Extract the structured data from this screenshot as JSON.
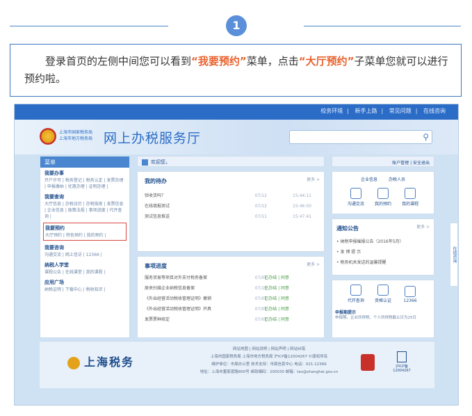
{
  "step": {
    "number": "1"
  },
  "instruction": {
    "part1": "登录首页的左侧中间您可以看到",
    "hl1": "“我要预约”",
    "part2": "菜单，点击",
    "hl2": "“大厅预约”",
    "part3": "子菜单您就可以进行预约啦。"
  },
  "topbar": {
    "links": [
      "校务环境",
      "新手上路",
      "常见问题",
      "在线咨询"
    ]
  },
  "header": {
    "bureau_line1": "上海市国家税务局",
    "bureau_line2": "上海市地方税务局",
    "title": "网上办税服务厅"
  },
  "sidebar": {
    "menu_label": "菜单",
    "groups": [
      {
        "title": "我要办事",
        "sub": "开户许可 | 税务登记 | 税务认定 | 发票办理 | 申报缴纳 | 优惠办理 | 证明办理 |"
      },
      {
        "title": "我要查询",
        "sub": "大厅信息 | 办税日历 | 办税指南 | 发票信息 | 企业信息 | 政策法规 | 事项进度 | 代开查询 |"
      },
      {
        "title": "我要预约",
        "sub": "大厅预约 | 特色预约 | 我的预约 |"
      },
      {
        "title": "我要咨询",
        "sub": "沟通交流 | 网上信访 | 12366 |"
      },
      {
        "title": "纳税人学堂",
        "sub": "课程公告 | 在线课堂 | 我的课程 |"
      },
      {
        "title": "应用广场",
        "sub": "纳税证明 | 下载中心 | 税收知识 |"
      }
    ]
  },
  "welcome": {
    "label": "欢迎您，"
  },
  "userbar": {
    "label": "账户管理 | 安全退出"
  },
  "todo": {
    "title": "我的待办",
    "more": "更多 >",
    "rows": [
      {
        "text": "验收货吗？",
        "date": "07/12",
        "time": "15:44:11"
      },
      {
        "text": "在线填报测试",
        "date": "07/12",
        "time": "15:46:50"
      },
      {
        "text": "测试信息推送",
        "date": "07/11",
        "time": "15:47:41"
      }
    ]
  },
  "progress": {
    "title": "事项进度",
    "more": "更多 >",
    "rows": [
      {
        "text": "服务贸易等项目对外支付税务备案",
        "date": "07/01",
        "status": "已办结 | 同意"
      },
      {
        "text": "原来扫描企业纳税信息备案",
        "date": "07/16",
        "status": "已办结 | 同意"
      },
      {
        "text": "《外出经营活动税收管理证明》缴销",
        "date": "07/01",
        "status": "已办结 | 同意"
      },
      {
        "text": "《外出经营活动税收管理证明》开具",
        "date": "07/01",
        "status": "已办结 | 同意"
      },
      {
        "text": "发票票种核定",
        "date": "07/01",
        "status": "已办结 | 同意"
      }
    ]
  },
  "rightpanel": {
    "links": [
      "企业信息",
      "办税人员"
    ],
    "icons": [
      "沟通交流",
      "我的预约",
      "我的课程"
    ],
    "notice_title": "通知公告",
    "notice_more": "更多 >",
    "notices": [
      "• 纳税申报催报公告（2016年5月）",
      "• 发 博 提 示",
      "• 税务机关发送的温馨提醒"
    ],
    "icons2": [
      "代开查询",
      "资格认证",
      "12366"
    ],
    "reminder_title": "申报期提示",
    "reminder_text": "申报期，企业所得税、个人所得税截止日为25日"
  },
  "footer": {
    "logo_text": "上海税务",
    "links": "网站地图 | 网站说明 | 网站声明 | 网站纠错",
    "line1": "上海市国家税务局 上海市地方税务局 沪ICP备12004267 ©版权所有",
    "line2": "维护单位：市局办公室  技术支持：市局信息中心  电话：021-12366",
    "line3": "地址：上海市董家渡路800号  邮政编码：200030  邮箱：tax@shanghai.gov.cn",
    "icp": "沪ICP备 12004267"
  },
  "side_tab": "在线咨询"
}
